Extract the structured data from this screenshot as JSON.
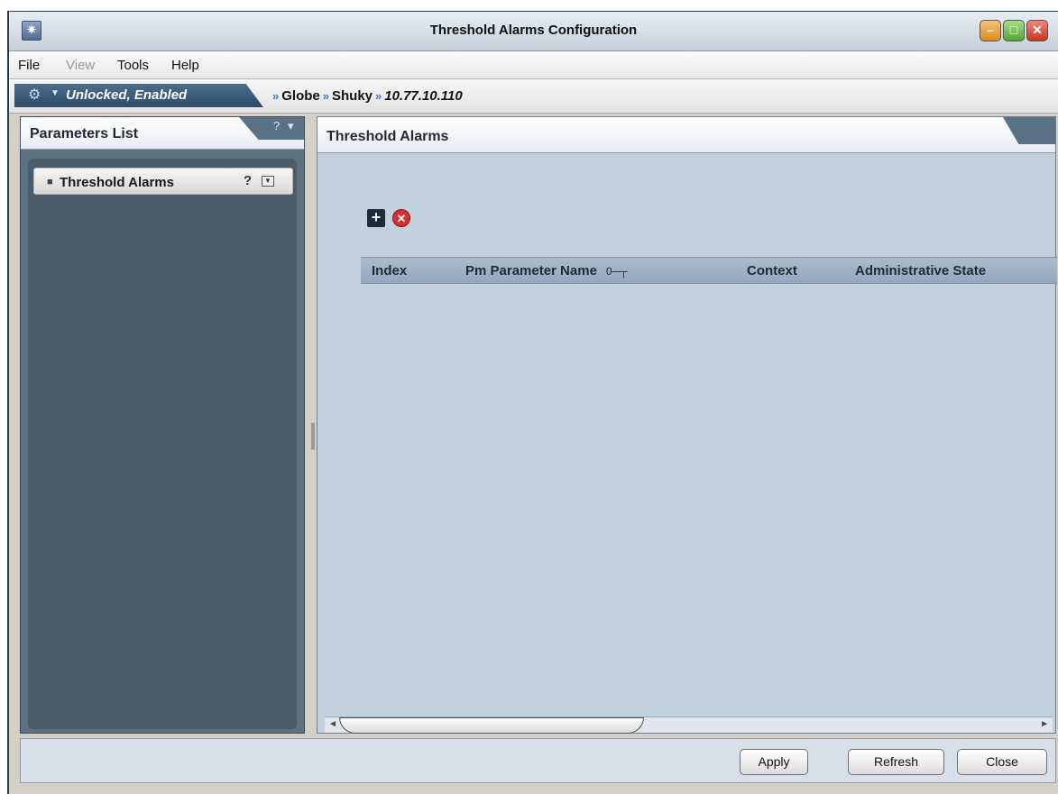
{
  "window": {
    "title": "Threshold Alarms Configuration"
  },
  "menu": {
    "file": "File",
    "view": "View",
    "tools": "Tools",
    "help": "Help"
  },
  "status": {
    "state": "Unlocked, Enabled"
  },
  "breadcrumb": {
    "items": [
      "Globe",
      "Shuky",
      "10.77.10.110"
    ]
  },
  "left_panel": {
    "title": "Parameters List",
    "items": [
      {
        "label": "Threshold Alarms",
        "help": "?"
      }
    ]
  },
  "right_panel": {
    "title": "Threshold Alarms",
    "table": {
      "columns": [
        "Index",
        "Pm Parameter Name",
        "Context",
        "Administrative State"
      ],
      "key_icon": "0─┬",
      "rows": []
    }
  },
  "buttons": {
    "apply": "Apply",
    "refresh": "Refresh",
    "close": "Close"
  },
  "icons": {
    "app": "app-icon",
    "lock": "lock-status-icon",
    "add": "add-icon",
    "delete": "delete-icon",
    "key": "key-icon"
  },
  "colors": {
    "accent": "#3b7bd4",
    "panel": "#5c7080",
    "content": "#c2d1de",
    "header": "#93a9bd"
  }
}
